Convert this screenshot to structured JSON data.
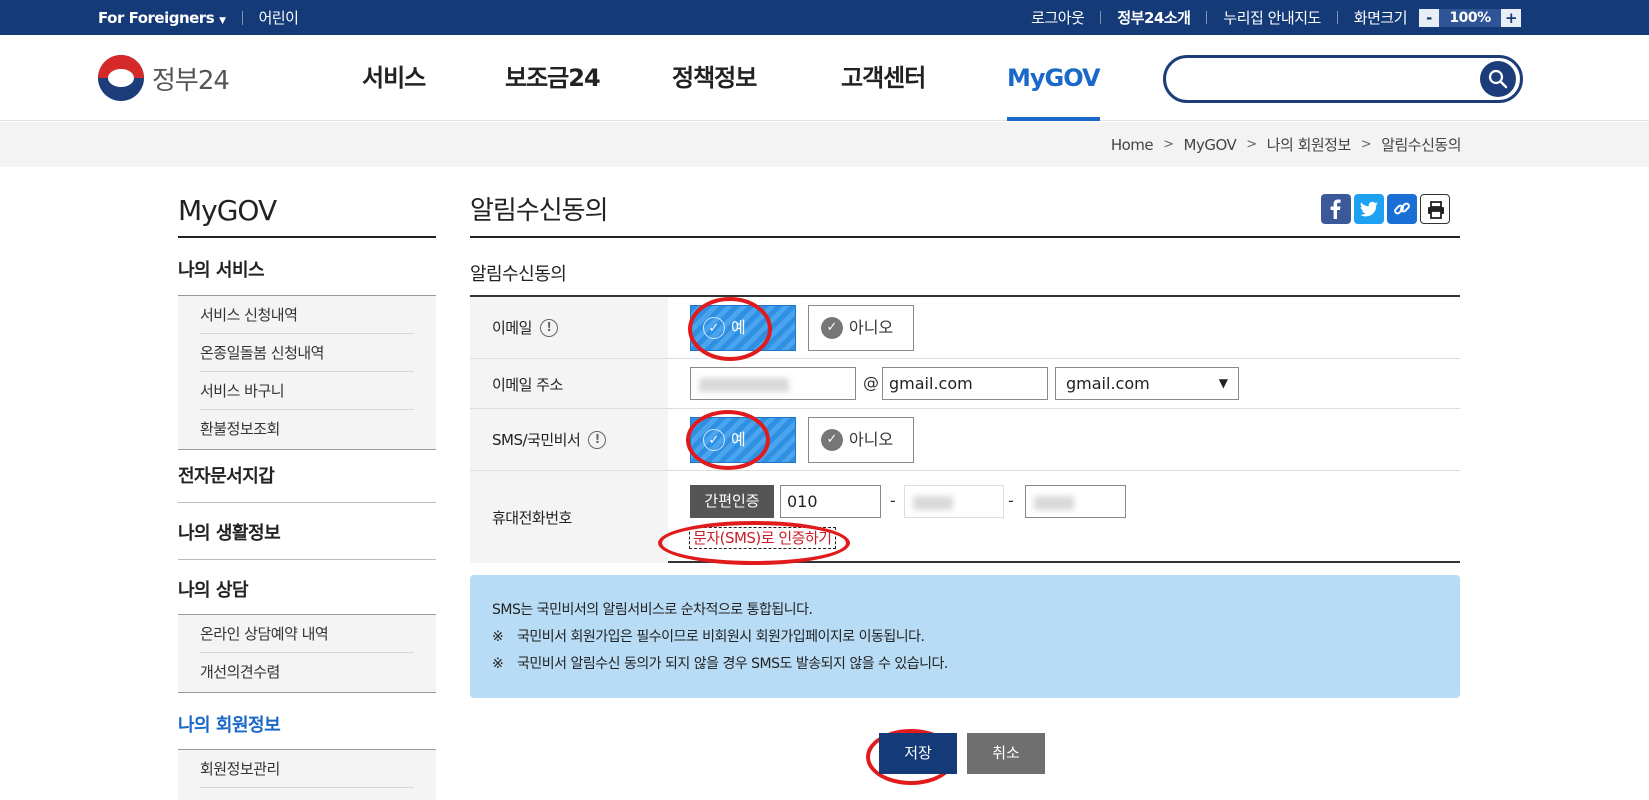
{
  "topbar": {
    "foreigners": "For Foreigners",
    "kids": "어린이",
    "logout": "로그아웃",
    "about": "정부24소개",
    "sitemap": "누리집 안내지도",
    "screen_size": "화면크기",
    "zoom_minus": "-",
    "zoom_value": "100%",
    "zoom_plus": "+"
  },
  "header": {
    "logo_text": "정부24",
    "nav": [
      "서비스",
      "보조금24",
      "정책정보",
      "고객센터",
      "MyGOV"
    ],
    "active_nav": "MyGOV",
    "search_placeholder": ""
  },
  "breadcrumb": [
    "Home",
    "MyGOV",
    "나의 회원정보",
    "알림수신동의"
  ],
  "sidebar": {
    "title": "MyGOV",
    "categories": [
      {
        "label": "나의 서비스",
        "items": [
          "서비스 신청내역",
          "온종일돌봄 신청내역",
          "서비스 바구니",
          "환불정보조회"
        ]
      },
      {
        "label": "전자문서지갑",
        "items": []
      },
      {
        "label": "나의 생활정보",
        "items": []
      },
      {
        "label": "나의 상담",
        "items": [
          "온라인 상담예약 내역",
          "개선의견수렴"
        ]
      },
      {
        "label": "나의 회원정보",
        "items": [
          "회원정보관리"
        ],
        "active": true
      }
    ]
  },
  "main": {
    "page_title": "알림수신동의",
    "section_title": "알림수신동의",
    "form": {
      "email_label": "이메일",
      "email_yes": "예",
      "email_no": "아니오",
      "email_selected": "예",
      "email_address_label": "이메일 주소",
      "email_at": "@",
      "email_domain": "gmail.com",
      "email_domain_select": "gmail.com",
      "sms_label": "SMS/국민비서",
      "sms_yes": "예",
      "sms_no": "아니오",
      "sms_selected": "예",
      "phone_label": "휴대전화번호",
      "cert_button": "간편인증",
      "phone_prefix": "010",
      "phone_dash": "-",
      "sms_cert_link": "문자(SMS)로 인증하기"
    },
    "notice": {
      "line1": "SMS는 국민비서의 알림서비스로 순차적으로 통합됩니다.",
      "mark": "※",
      "line2": "국민비서 회원가입은 필수이므로 비회원시 회원가입페이지로 이동됩니다.",
      "line3": "국민비서 알림수신 동의가 되지 않을 경우 SMS도 발송되지 않을 수 있습니다."
    },
    "buttons": {
      "save": "저장",
      "cancel": "취소"
    }
  },
  "colors": {
    "topbar": "#143a78",
    "accent": "#1a69c9",
    "highlight": "#e11b1b",
    "notice_bg": "#b9dcf6",
    "selected_button": "#2e8fe3"
  },
  "icons": [
    "chevron-down-icon",
    "search-icon",
    "info-icon",
    "check-icon",
    "facebook-icon",
    "twitter-icon",
    "link-icon",
    "print-icon"
  ]
}
